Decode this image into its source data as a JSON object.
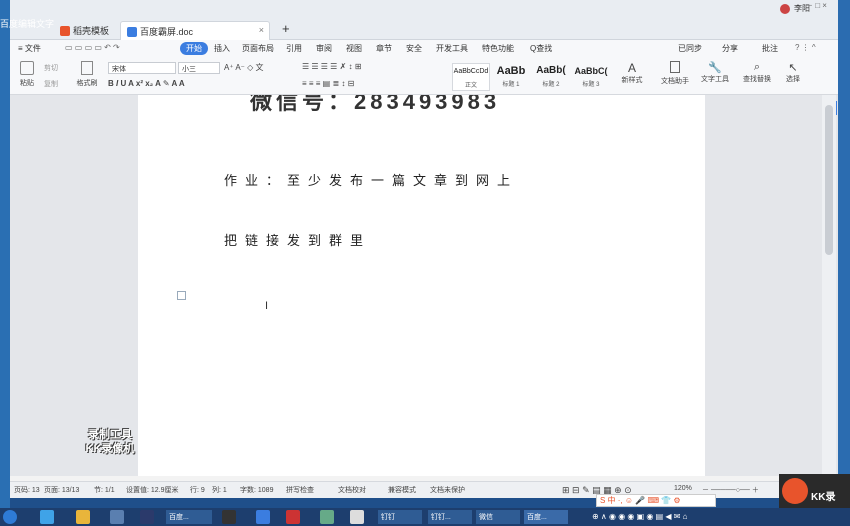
{
  "desktop": {
    "title": "百度编辑文字"
  },
  "tabs": [
    {
      "label": "稻壳模板",
      "color": "#e8542c"
    },
    {
      "label": "百度霸屏.doc",
      "color": "#3b7de0"
    }
  ],
  "window_controls": {
    "user": "李阳"
  },
  "menu": {
    "file": "≡ 文件",
    "items": [
      "开始",
      "插入",
      "页面布局",
      "引用",
      "审阅",
      "视图",
      "章节",
      "安全",
      "开发工具",
      "特色功能",
      "Q查找"
    ],
    "right": [
      "已同步",
      "分享",
      "批注"
    ]
  },
  "ribbon": {
    "paste": "粘贴",
    "cut": "剪切",
    "copy": "复制",
    "format_painter": "格式刷",
    "font": "宋体",
    "size": "小三",
    "styles": [
      {
        "preview": "AaBbCcDd",
        "label": "正文"
      },
      {
        "preview": "AaBb",
        "label": "标题 1"
      },
      {
        "preview": "AaBb(",
        "label": "标题 2"
      },
      {
        "preview": "AaBbC(",
        "label": "标题 3"
      }
    ],
    "new_style": "新样式",
    "doc_helper": "文档助手",
    "text_tools": "文字工具",
    "find_replace": "查找替换",
    "select": "选择"
  },
  "document": {
    "top_line": "微信号：283493983",
    "para1": "作业：至少发布一篇文章到网上",
    "para2": "把链接发到群里"
  },
  "status": {
    "page": "页码: 13",
    "pages": "页面: 13/13",
    "section": "节: 1/1",
    "setting": "设置值: 12.9厘米",
    "row": "行: 9",
    "col": "列: 1",
    "words": "字数: 1089",
    "spell": "拼写检查",
    "proof": "文档校对",
    "compat": "兼容模式",
    "protect": "文档未保护",
    "zoom": "120%"
  },
  "watermark": {
    "line1": "录制工具",
    "line2": "KK录像机"
  },
  "kk_logo": "KK录",
  "taskbar": [
    {
      "label": "百度..."
    },
    {
      "label": "钉钉"
    },
    {
      "label": "钉钉..."
    },
    {
      "label": "微信"
    },
    {
      "label": "百度..."
    }
  ]
}
